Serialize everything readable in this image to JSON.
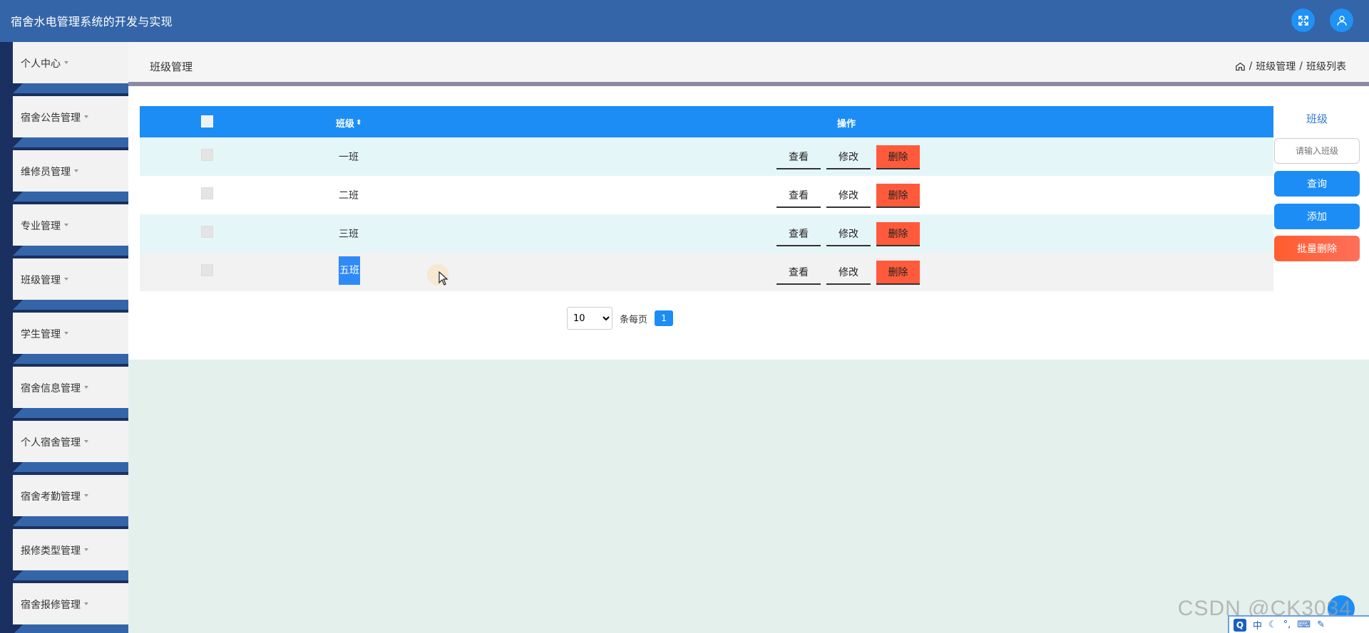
{
  "app": {
    "title": "宿舍水电管理系统的开发与实现"
  },
  "sidebar": {
    "items": [
      {
        "label": "个人中心"
      },
      {
        "label": "宿舍公告管理"
      },
      {
        "label": "维修员管理"
      },
      {
        "label": "专业管理"
      },
      {
        "label": "班级管理"
      },
      {
        "label": "学生管理"
      },
      {
        "label": "宿舍信息管理"
      },
      {
        "label": "个人宿舍管理"
      },
      {
        "label": "宿舍考勤管理"
      },
      {
        "label": "报修类型管理"
      },
      {
        "label": "宿舍报修管理"
      }
    ]
  },
  "header": {
    "page_title": "班级管理",
    "breadcrumb": [
      "班级管理",
      "班级列表"
    ],
    "separator": "/"
  },
  "table": {
    "columns": {
      "class": "班级",
      "ops": "操作"
    },
    "rows": [
      {
        "class": "一班"
      },
      {
        "class": "二班"
      },
      {
        "class": "三班"
      },
      {
        "class": "五班"
      }
    ],
    "actions": {
      "view": "查看",
      "edit": "修改",
      "delete": "删除"
    }
  },
  "pagination": {
    "page_size": "10",
    "page_size_options": [
      "10"
    ],
    "per_page_label": "条每页",
    "current_page": "1"
  },
  "search": {
    "label": "班级",
    "placeholder": "请输入班级",
    "query_label": "查询",
    "add_label": "添加",
    "batch_delete_label": "批量删除"
  },
  "watermark": "CSDN @CK3034",
  "ime": {
    "lang": "中",
    "logo": "Q"
  },
  "colors": {
    "topbar": "#3465a8",
    "primary": "#1c8df5",
    "danger": "#ff5a3c",
    "sidebar_dark": "#193060"
  }
}
